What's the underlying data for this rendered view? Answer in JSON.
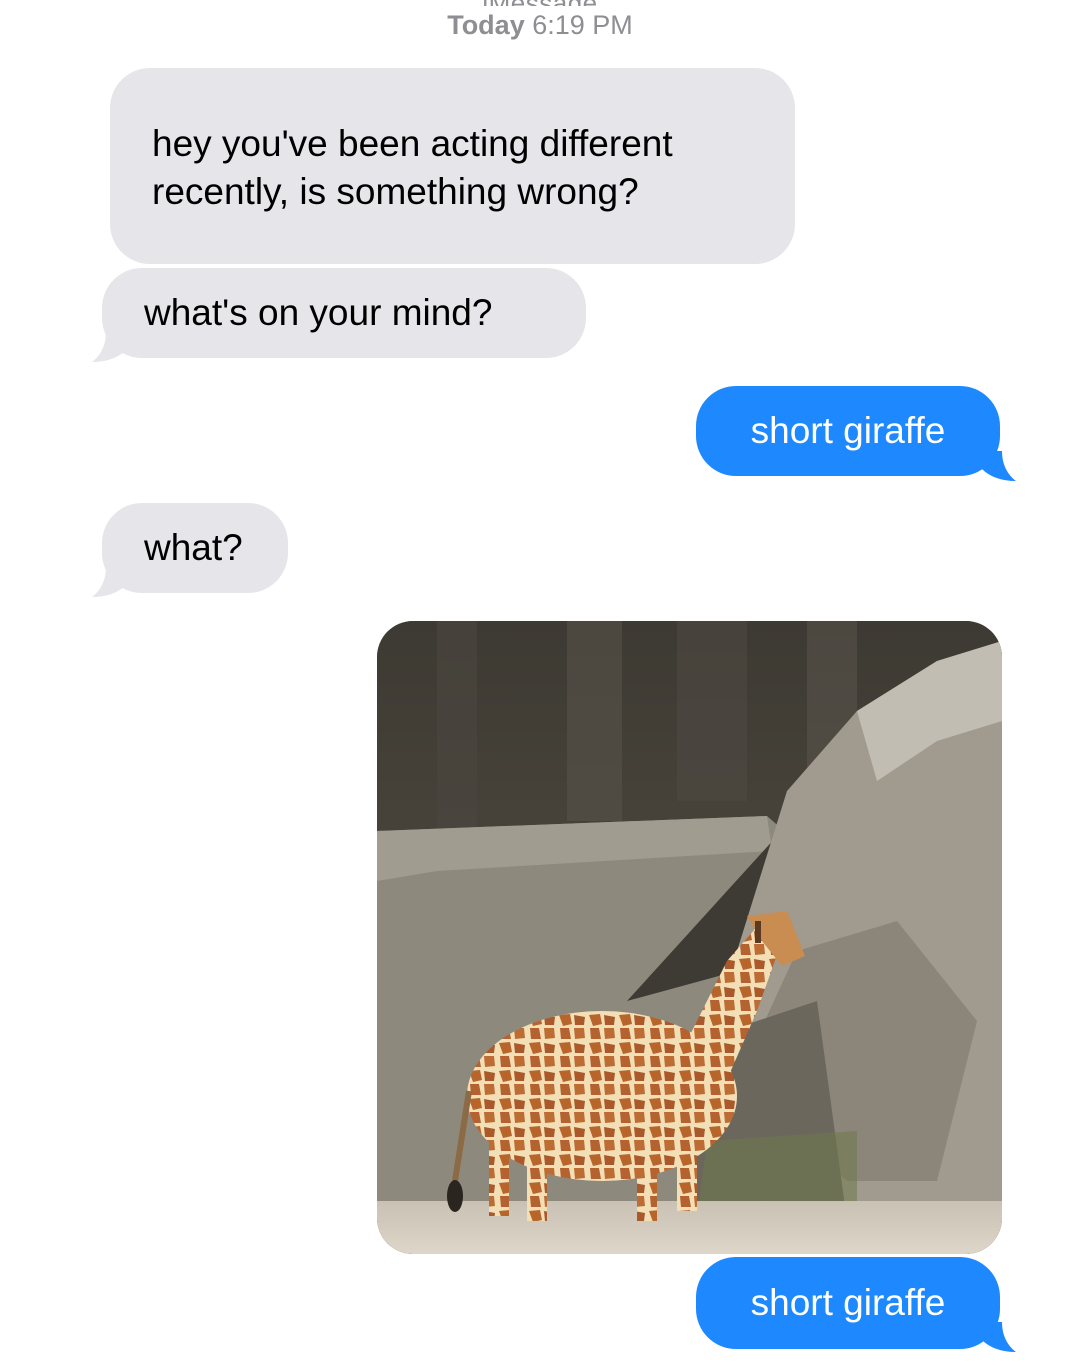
{
  "conversation": {
    "timestamp_day": "Today",
    "timestamp_time": "6:19 PM"
  },
  "messages": [
    {
      "direction": "received",
      "text": "hey you've been acting different recently, is something wrong?"
    },
    {
      "direction": "received",
      "text": "what's on your mind?"
    },
    {
      "direction": "sent",
      "text": "short giraffe"
    },
    {
      "direction": "received",
      "text": "what?"
    },
    {
      "direction": "sent",
      "attachment": "photo"
    },
    {
      "direction": "sent",
      "text": "short giraffe"
    }
  ],
  "colors": {
    "received_bubble": "#e5e5ea",
    "sent_bubble": "#1e88ff",
    "timestamp": "#8e8e93"
  }
}
